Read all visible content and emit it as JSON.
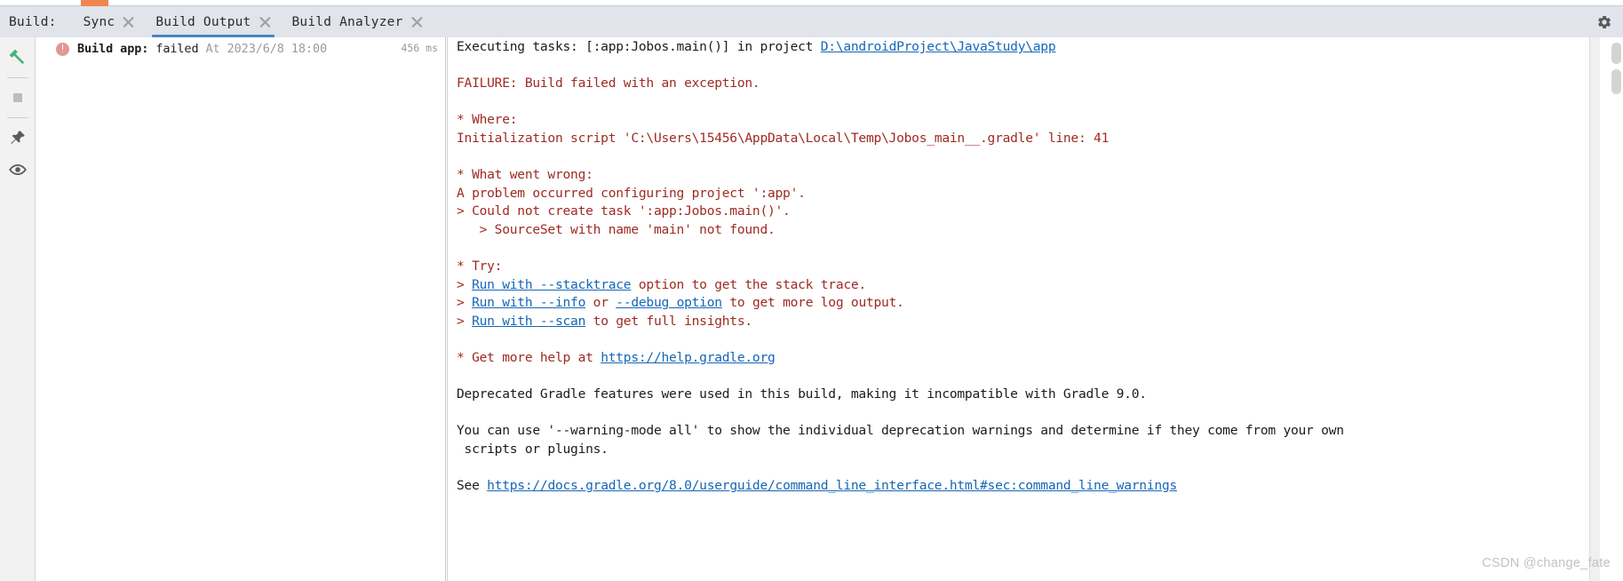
{
  "window": {
    "tool_window_label": "Build:",
    "gear_icon": "gear-icon"
  },
  "tabs": [
    {
      "label": "Sync",
      "selected": false,
      "closable": true
    },
    {
      "label": "Build Output",
      "selected": true,
      "closable": true
    },
    {
      "label": "Build Analyzer",
      "selected": false,
      "closable": true
    }
  ],
  "toolbar": {
    "items": [
      {
        "name": "build-hammer-icon",
        "title": "Build",
        "color": "#4caf7d"
      },
      {
        "name": "stop-icon",
        "title": "Stop",
        "color": "#b8b8b8"
      },
      {
        "name": "pin-icon",
        "title": "Pin",
        "color": "#5a5a5a"
      },
      {
        "name": "eye-icon",
        "title": "Show",
        "color": "#5a5a5a"
      }
    ]
  },
  "tree": {
    "node": {
      "icon": "error-icon",
      "title": "Build app:",
      "status": "failed",
      "timestamp_prefix": "At",
      "timestamp": "2023/6/8 18:00",
      "duration": "456 ms"
    }
  },
  "console": {
    "lines": [
      {
        "id": "l01",
        "spans": [
          {
            "text": "Executing tasks: [:app:Jobos.main()] in project ",
            "style": "dark"
          },
          {
            "text": "D:\\androidProject\\JavaStudy\\app",
            "style": "link"
          }
        ]
      },
      {
        "id": "l02",
        "spans": []
      },
      {
        "id": "l03",
        "spans": [
          {
            "text": "FAILURE: Build failed with an exception.",
            "style": "red"
          }
        ]
      },
      {
        "id": "l04",
        "spans": []
      },
      {
        "id": "l05",
        "spans": [
          {
            "text": "* Where:",
            "style": "red"
          }
        ]
      },
      {
        "id": "l06",
        "spans": [
          {
            "text": "Initialization script 'C:\\Users\\15456\\AppData\\Local\\Temp\\Jobos_main__.gradle' line: 41",
            "style": "red"
          }
        ]
      },
      {
        "id": "l07",
        "spans": []
      },
      {
        "id": "l08",
        "spans": [
          {
            "text": "* What went wrong:",
            "style": "red"
          }
        ]
      },
      {
        "id": "l09",
        "spans": [
          {
            "text": "A problem occurred configuring project ':app'.",
            "style": "red"
          }
        ]
      },
      {
        "id": "l10",
        "spans": [
          {
            "text": "> Could not create task ':app:Jobos.main()'.",
            "style": "red"
          }
        ]
      },
      {
        "id": "l11",
        "spans": [
          {
            "text": "   > SourceSet with name 'main' not found.",
            "style": "red"
          }
        ]
      },
      {
        "id": "l12",
        "spans": []
      },
      {
        "id": "l13",
        "spans": [
          {
            "text": "* Try:",
            "style": "red"
          }
        ]
      },
      {
        "id": "l14",
        "spans": [
          {
            "text": "> ",
            "style": "red"
          },
          {
            "text": "Run with --stacktrace",
            "style": "link"
          },
          {
            "text": " option to get the stack trace.",
            "style": "red"
          }
        ]
      },
      {
        "id": "l15",
        "spans": [
          {
            "text": "> ",
            "style": "red"
          },
          {
            "text": "Run with --info",
            "style": "link"
          },
          {
            "text": " or ",
            "style": "red"
          },
          {
            "text": "--debug option",
            "style": "link"
          },
          {
            "text": " to get more log output.",
            "style": "red"
          }
        ]
      },
      {
        "id": "l16",
        "spans": [
          {
            "text": "> ",
            "style": "red"
          },
          {
            "text": "Run with --scan",
            "style": "link"
          },
          {
            "text": " to get full insights.",
            "style": "red"
          }
        ]
      },
      {
        "id": "l17",
        "spans": []
      },
      {
        "id": "l18",
        "spans": [
          {
            "text": "* Get more help at ",
            "style": "red"
          },
          {
            "text": "https://help.gradle.org",
            "style": "link"
          }
        ]
      },
      {
        "id": "l19",
        "spans": []
      },
      {
        "id": "l20",
        "spans": [
          {
            "text": "Deprecated Gradle features were used in this build, making it incompatible with Gradle 9.0.",
            "style": "dark"
          }
        ]
      },
      {
        "id": "l21",
        "spans": []
      },
      {
        "id": "l22",
        "spans": [
          {
            "text": "You can use '--warning-mode all' to show the individual deprecation warnings and determine if they come from your own",
            "style": "dark"
          }
        ]
      },
      {
        "id": "l23",
        "spans": [
          {
            "text": " scripts or plugins.",
            "style": "dark"
          }
        ]
      },
      {
        "id": "l24",
        "spans": []
      },
      {
        "id": "l25",
        "spans": [
          {
            "text": "See ",
            "style": "dark"
          },
          {
            "text": "https://docs.gradle.org/8.0/userguide/command_line_interface.html#sec:command_line_warnings",
            "style": "link"
          }
        ]
      }
    ]
  },
  "scrollbar": {
    "markers": [
      {
        "name": "scroll-thumb-top"
      },
      {
        "name": "scroll-thumb-second"
      }
    ]
  },
  "watermark": {
    "text": "CSDN @change_fate"
  },
  "colors": {
    "tabbar_bg": "#e1e4ea",
    "tab_underline": "#4a84c4",
    "error_text": "#9e2a21",
    "link": "#1466b8",
    "error_icon": "#e49693",
    "build_icon_green": "#4caf7d",
    "accent_orange": "#f0864f"
  }
}
